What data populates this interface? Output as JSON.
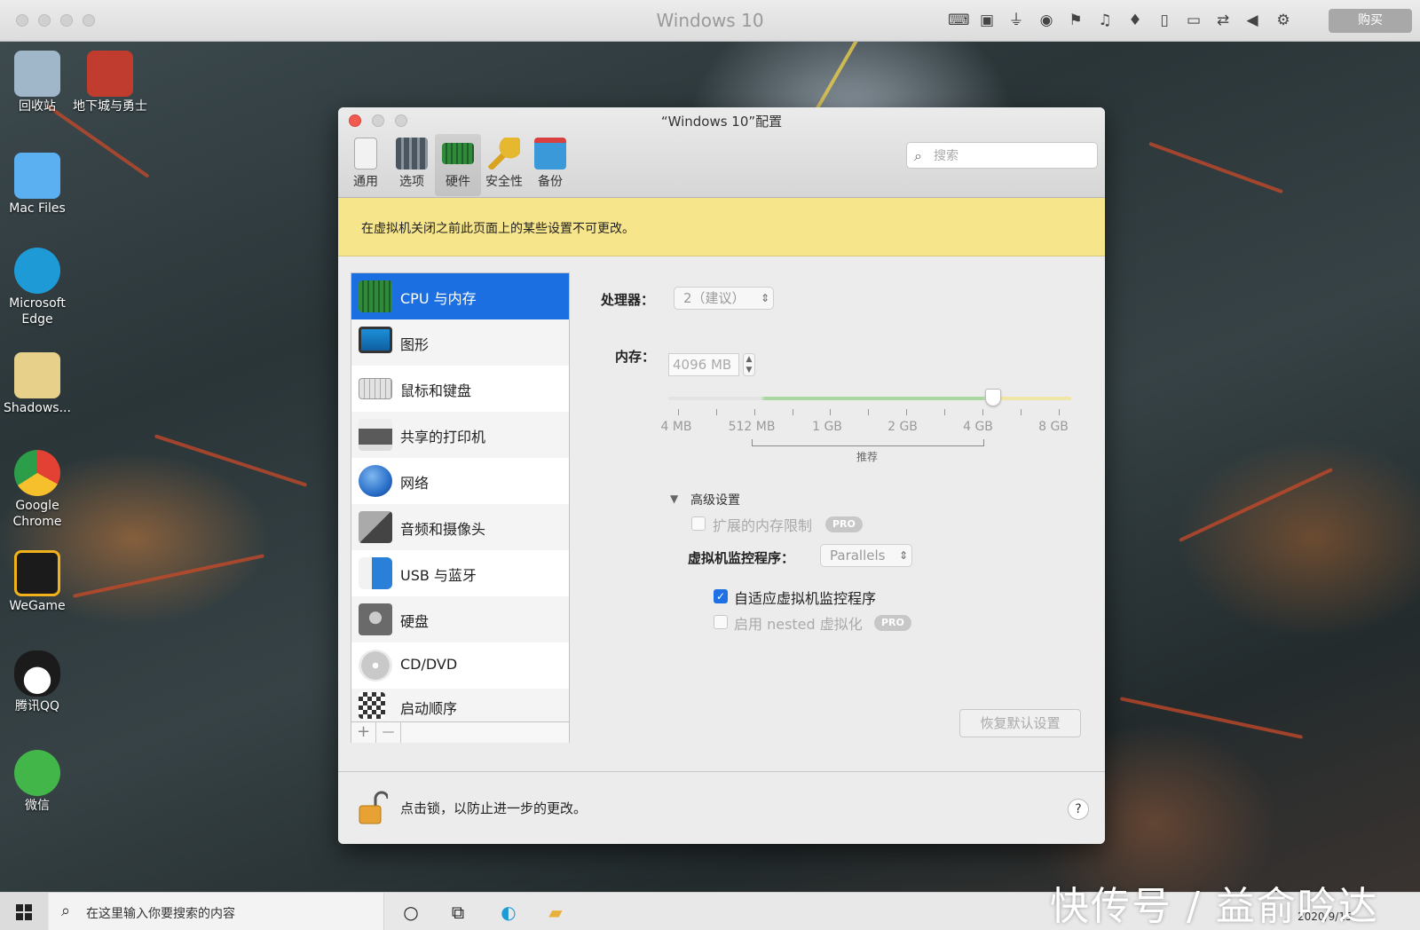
{
  "host": {
    "title": "Windows 10",
    "buy_label": "购买",
    "toolbar_icons": [
      "keyboard-icon",
      "cpu-icon",
      "usb-icon",
      "cd-icon",
      "flag-icon",
      "speaker-icon",
      "microphone-icon",
      "tablet-icon",
      "camera-icon",
      "share-icon",
      "back-triangle-icon",
      "gear-icon"
    ]
  },
  "desktop": {
    "icons": [
      {
        "name": "recycle-bin",
        "label": "回收站",
        "color": "#9fb7c9"
      },
      {
        "name": "dnf",
        "label": "地下城与勇士",
        "color": "#c03c2e"
      },
      {
        "name": "mac-files",
        "label": "Mac Files",
        "color": "#5ab0f0"
      },
      {
        "name": "edge",
        "label": "Microsoft Edge",
        "color": "#1e9bd7"
      },
      {
        "name": "shadows",
        "label": "Shadows...",
        "color": "#e6d08a"
      },
      {
        "name": "chrome",
        "label": "Google Chrome",
        "color": "#e34133"
      },
      {
        "name": "wegame",
        "label": "WeGame",
        "color": "#f2b21b"
      },
      {
        "name": "qq",
        "label": "腾讯QQ",
        "color": "#1b1b1b"
      },
      {
        "name": "wechat",
        "label": "微信",
        "color": "#43b649"
      }
    ]
  },
  "config": {
    "title": "“Windows 10”配置",
    "toolbar": [
      {
        "label": "通用",
        "icon": "general-icon",
        "color": "#f2f2f2"
      },
      {
        "label": "选项",
        "icon": "options-icon",
        "color": "#4a5560"
      },
      {
        "label": "硬件",
        "icon": "hardware-icon",
        "color": "#2f8a3a"
      },
      {
        "label": "安全性",
        "icon": "key-icon",
        "color": "#d9a320"
      },
      {
        "label": "备份",
        "icon": "backup-icon",
        "color": "#3a9ad9"
      }
    ],
    "search_placeholder": "搜索",
    "notice": "在虚拟机关闭之前此页面上的某些设置不可更改。",
    "sidebar": [
      {
        "label": "CPU 与内存",
        "icon": "cpu-memory-icon",
        "color": "#2f8a3a"
      },
      {
        "label": "图形",
        "icon": "monitor-icon",
        "color": "#1c8fd8"
      },
      {
        "label": "鼠标和键盘",
        "icon": "keyboard-icon",
        "color": "#d8d8d8"
      },
      {
        "label": "共享的打印机",
        "icon": "printer-icon",
        "color": "#5a5a5a"
      },
      {
        "label": "网络",
        "icon": "globe-icon",
        "color": "#2a6fc9"
      },
      {
        "label": "音频和摄像头",
        "icon": "audio-camera-icon",
        "color": "#7a7a7a"
      },
      {
        "label": "USB 与蓝牙",
        "icon": "usb-bluetooth-icon",
        "color": "#2a7fd8"
      },
      {
        "label": "硬盘",
        "icon": "hard-disk-icon",
        "color": "#6a6a6a"
      },
      {
        "label": "CD/DVD",
        "icon": "cd-dvd-icon",
        "color": "#c9c9c9"
      },
      {
        "label": "启动顺序",
        "icon": "checkered-flag-icon",
        "color": "#333333"
      }
    ],
    "sidebar_add": "+",
    "sidebar_remove": "—",
    "processor_label": "处理器：",
    "processor_value": "2（建议）",
    "memory_label": "内存：",
    "memory_value": "4096 MB",
    "memory_slider": {
      "min_mb": 4,
      "max_mb": 8192,
      "value_mb": 4096,
      "recommended_start": "512 MB",
      "recommended_end": "4 GB"
    },
    "memory_ticks": [
      "4 MB",
      "512 MB",
      "1 GB",
      "2 GB",
      "4 GB",
      "8 GB"
    ],
    "recommended_label": "推荐",
    "advanced_label": "高级设置",
    "extended_memory_label": "扩展的内存限制",
    "pro_label": "PRO",
    "hypervisor_label": "虚拟机监控程序：",
    "hypervisor_value": "Parallels",
    "adaptive_hypervisor_label": "自适应虚拟机监控程序",
    "adaptive_hypervisor_checked": true,
    "nested_label": "启用 nested 虚拟化",
    "nested_checked": false,
    "extended_memory_checked": false,
    "restore_label": "恢复默认设置",
    "lock_text": "点击锁，以防止进一步的更改。",
    "help_label": "?"
  },
  "taskbar": {
    "search_placeholder": "在这里输入你要搜索的内容",
    "date": "2020/9/15"
  },
  "watermark": "快传号 / 益俞吟达"
}
